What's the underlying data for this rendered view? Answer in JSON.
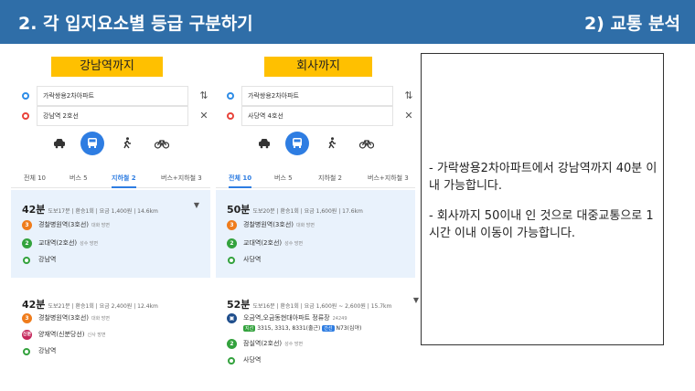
{
  "header": {
    "title": "2. 각 입지요소별 등급 구분하기",
    "section": "2) 교통 분석"
  },
  "panels": [
    {
      "tag": "강남역까지",
      "start": "가락쌍용2차아파트",
      "end": "강남역 2호선",
      "tabs": [
        "전체 10",
        "버스 5",
        "지하철 2",
        "버스+지하철 3"
      ],
      "active_tab": 2,
      "routes": [
        {
          "time": "42분",
          "meta": "도보17분 | 환승1회 | 요금 1,400원 | 14.6km",
          "steps": [
            {
              "badge": "3",
              "name": "경찰병원역(3호선)",
              "sub": "대화 방면"
            },
            {
              "badge": "2",
              "name": "교대역(2호선)",
              "sub": "성수 방면"
            },
            {
              "badge": "",
              "name": "강남역",
              "sub": ""
            }
          ]
        },
        {
          "time": "42분",
          "meta": "도보21분 | 환승1회 | 요금 2,400원 | 12.4km",
          "steps": [
            {
              "badge": "3",
              "name": "경찰병원역(3호선)",
              "sub": "대화 방면"
            },
            {
              "badge": "신분",
              "name": "양재역(신분당선)",
              "sub": "신사 방면"
            },
            {
              "badge": "",
              "name": "강남역",
              "sub": ""
            }
          ]
        }
      ]
    },
    {
      "tag": "회사까지",
      "start": "가락쌍용2차아파트",
      "end": "사당역 4호선",
      "tabs": [
        "전체 10",
        "버스 5",
        "지하철 2",
        "버스+지하철 3"
      ],
      "active_tab": 0,
      "routes": [
        {
          "time": "50분",
          "meta": "도보20분 | 환승1회 | 요금 1,600원 | 17.6km",
          "steps": [
            {
              "badge": "3",
              "name": "경찰병원역(3호선)",
              "sub": "대화 방면"
            },
            {
              "badge": "2",
              "name": "교대역(2호선)",
              "sub": "성수 방면"
            },
            {
              "badge": "",
              "name": "사당역",
              "sub": ""
            }
          ]
        },
        {
          "time": "52분",
          "meta": "도보16분 | 환승1회 | 요금 1,600원 ~ 2,600원 | 15.7km",
          "steps": [
            {
              "badge": "bus",
              "name": "오금역,오금동현대아파트 정류장",
              "sub": "24249"
            },
            {
              "badge": "2",
              "name": "잠실역(2호선)",
              "sub": "성수 방면"
            },
            {
              "badge": "",
              "name": "사당역",
              "sub": ""
            }
          ],
          "bus_tag_g": "지선",
          "bus_lines": "3315, 3313, 8331(출근)",
          "bus_tag_b": "간선",
          "bus_night": "N73(심야)"
        }
      ]
    }
  ],
  "notes": [
    "- 가락쌍용2차아파트에서 강남역까지 40분 이내 가능합니다.",
    "- 회사까지 50이내 인 것으로 대중교통으로 1시간 이내 이동이 가능합니다."
  ],
  "icons": {
    "swap": "swap-icon",
    "clear": "close-icon",
    "car": "car-icon",
    "bus": "bus-icon",
    "walk": "walk-icon",
    "bike": "bike-icon",
    "caret": "chevron-down-icon"
  },
  "colors": {
    "header": "#2f6ea8",
    "tag": "#ffc000",
    "accent": "#2e7de2",
    "line3": "#ef7c1c",
    "line2": "#33a23d",
    "shinbundang": "#c5275c"
  }
}
